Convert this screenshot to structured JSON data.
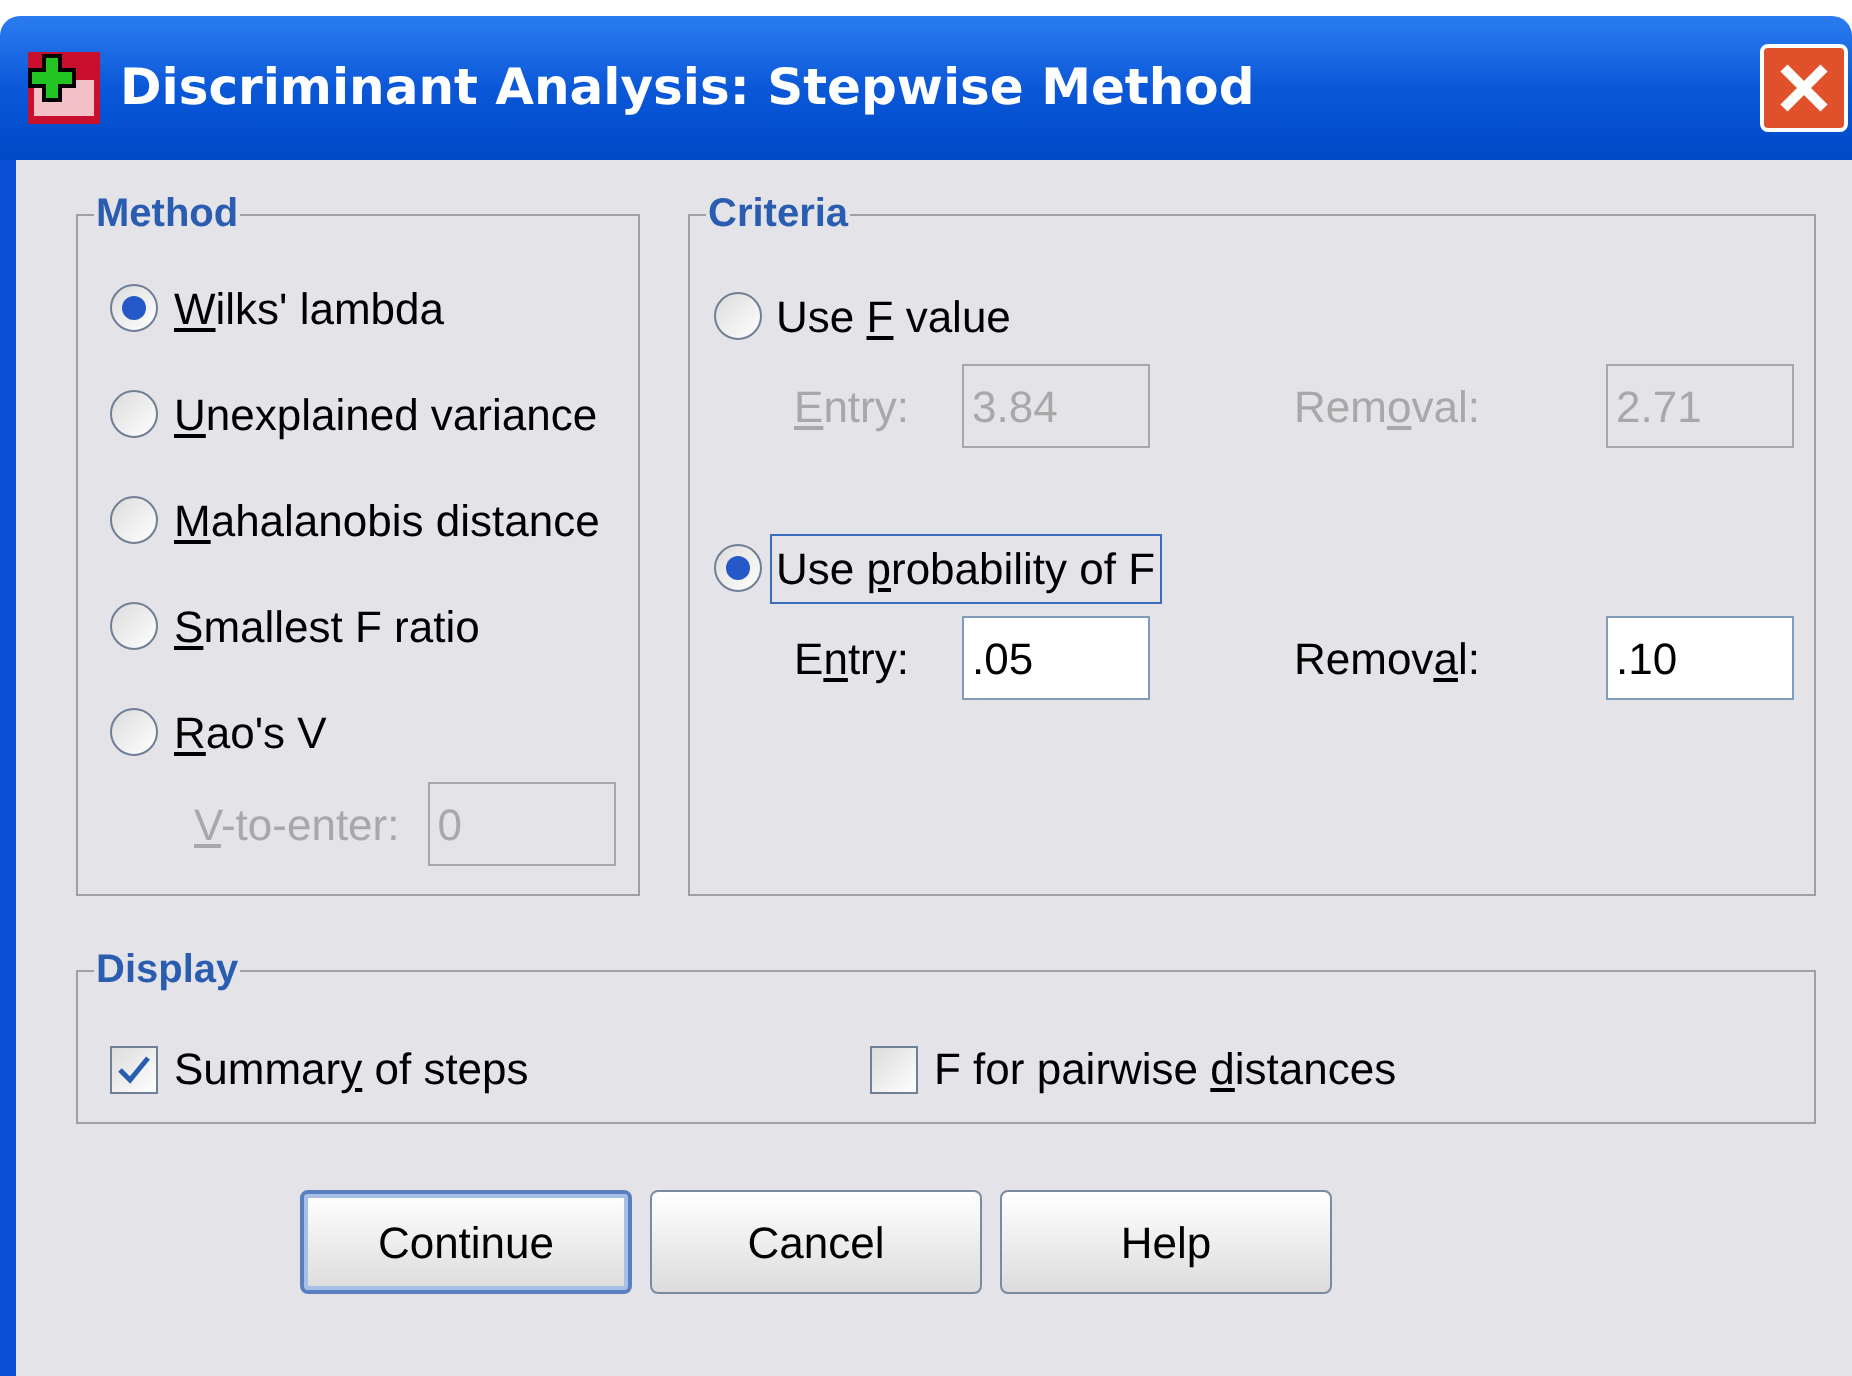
{
  "window": {
    "title": "Discriminant Analysis: Stepwise Method"
  },
  "method": {
    "title": "Method",
    "options": [
      {
        "label": {
          "key": "W",
          "post": "ilks' lambda"
        },
        "selected": true
      },
      {
        "label": {
          "key": "U",
          "post": "nexplained variance"
        },
        "selected": false
      },
      {
        "label": {
          "key": "M",
          "post": "ahalanobis distance"
        },
        "selected": false
      },
      {
        "label": {
          "key": "S",
          "post": "mallest F ratio"
        },
        "selected": false
      },
      {
        "label": {
          "key": "R",
          "post": "ao's V"
        },
        "selected": false
      }
    ],
    "v_to_enter": {
      "label": {
        "key": "V",
        "post": "-to-enter:"
      },
      "value": "0",
      "disabled": true
    }
  },
  "criteria": {
    "title": "Criteria",
    "options": [
      {
        "label": {
          "pre": "Use ",
          "key": "F",
          "post": " value"
        },
        "selected": false,
        "focused": false,
        "fields": [
          {
            "label": {
              "key": "E",
              "post": "ntry:"
            },
            "value": "3.84",
            "disabled": true
          },
          {
            "label": {
              "pre": "Rem",
              "key": "o",
              "post": "val:"
            },
            "value": "2.71",
            "disabled": true
          }
        ]
      },
      {
        "label": {
          "pre": "Use ",
          "key": "p",
          "post": "robability of F"
        },
        "selected": true,
        "focused": true,
        "fields": [
          {
            "label": {
              "pre": "E",
              "key": "n",
              "post": "try:"
            },
            "value": ".05",
            "disabled": false
          },
          {
            "label": {
              "pre": "Remov",
              "key": "a",
              "post": "l:"
            },
            "value": ".10",
            "disabled": false
          }
        ]
      }
    ]
  },
  "display": {
    "title": "Display",
    "checkboxes": [
      {
        "label": {
          "pre": "Summar",
          "key": "y",
          "post": " of steps"
        },
        "checked": true
      },
      {
        "label": {
          "pre": "F for pairwise ",
          "key": "d",
          "post": "istances"
        },
        "checked": false
      }
    ]
  },
  "buttons": [
    {
      "label": "Continue",
      "default": true
    },
    {
      "label": "Cancel",
      "default": false
    },
    {
      "label": "Help",
      "default": false
    }
  ]
}
